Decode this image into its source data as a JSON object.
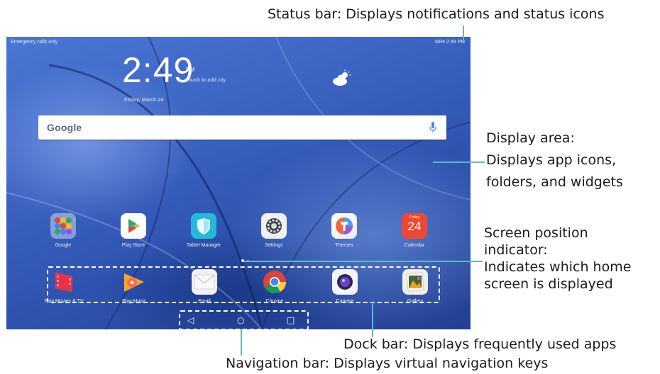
{
  "callouts": {
    "status_bar": "Status bar: Displays notifications and status icons",
    "display_area": [
      "Display area:",
      "Displays app icons,",
      "folders, and widgets"
    ],
    "screen_position": [
      "Screen position",
      "indicator:",
      "Indicates which home",
      "screen is displayed"
    ],
    "dock_bar": "Dock bar: Displays frequently used apps",
    "navigation_bar": "Navigation bar: Displays virtual navigation keys"
  },
  "statusbar": {
    "left_text": "Emergency calls only",
    "right_text": "66%  2:49 PM"
  },
  "clock_widget": {
    "time": "2:49",
    "ampm": "PM",
    "add_city": "Touch to add city",
    "date": "Friday, March 24"
  },
  "search": {
    "logo": "Google"
  },
  "apps_row": [
    {
      "label": "Google",
      "icon": "google-folder-icon"
    },
    {
      "label": "Play Store",
      "icon": "play-store-icon"
    },
    {
      "label": "Tablet Manager",
      "icon": "tablet-manager-icon"
    },
    {
      "label": "Settings",
      "icon": "settings-icon"
    },
    {
      "label": "Themes",
      "icon": "themes-icon"
    },
    {
      "label": "Calendar",
      "icon": "calendar-icon",
      "day_name": "Friday",
      "day_number": "24"
    }
  ],
  "dock": [
    {
      "label": "Play Movies & TV",
      "icon": "play-movies-icon"
    },
    {
      "label": "Play Music",
      "icon": "play-music-icon"
    },
    {
      "label": "Email",
      "icon": "email-icon"
    },
    {
      "label": "Chrome",
      "icon": "chrome-icon"
    },
    {
      "label": "Camera",
      "icon": "camera-icon"
    },
    {
      "label": "Gallery",
      "icon": "gallery-icon"
    }
  ],
  "navigation": {
    "back": "◁",
    "home": "○",
    "recents": "□"
  },
  "colors": {
    "callout_line": "#5fb8c8",
    "wallpaper": "#3c63c2"
  }
}
